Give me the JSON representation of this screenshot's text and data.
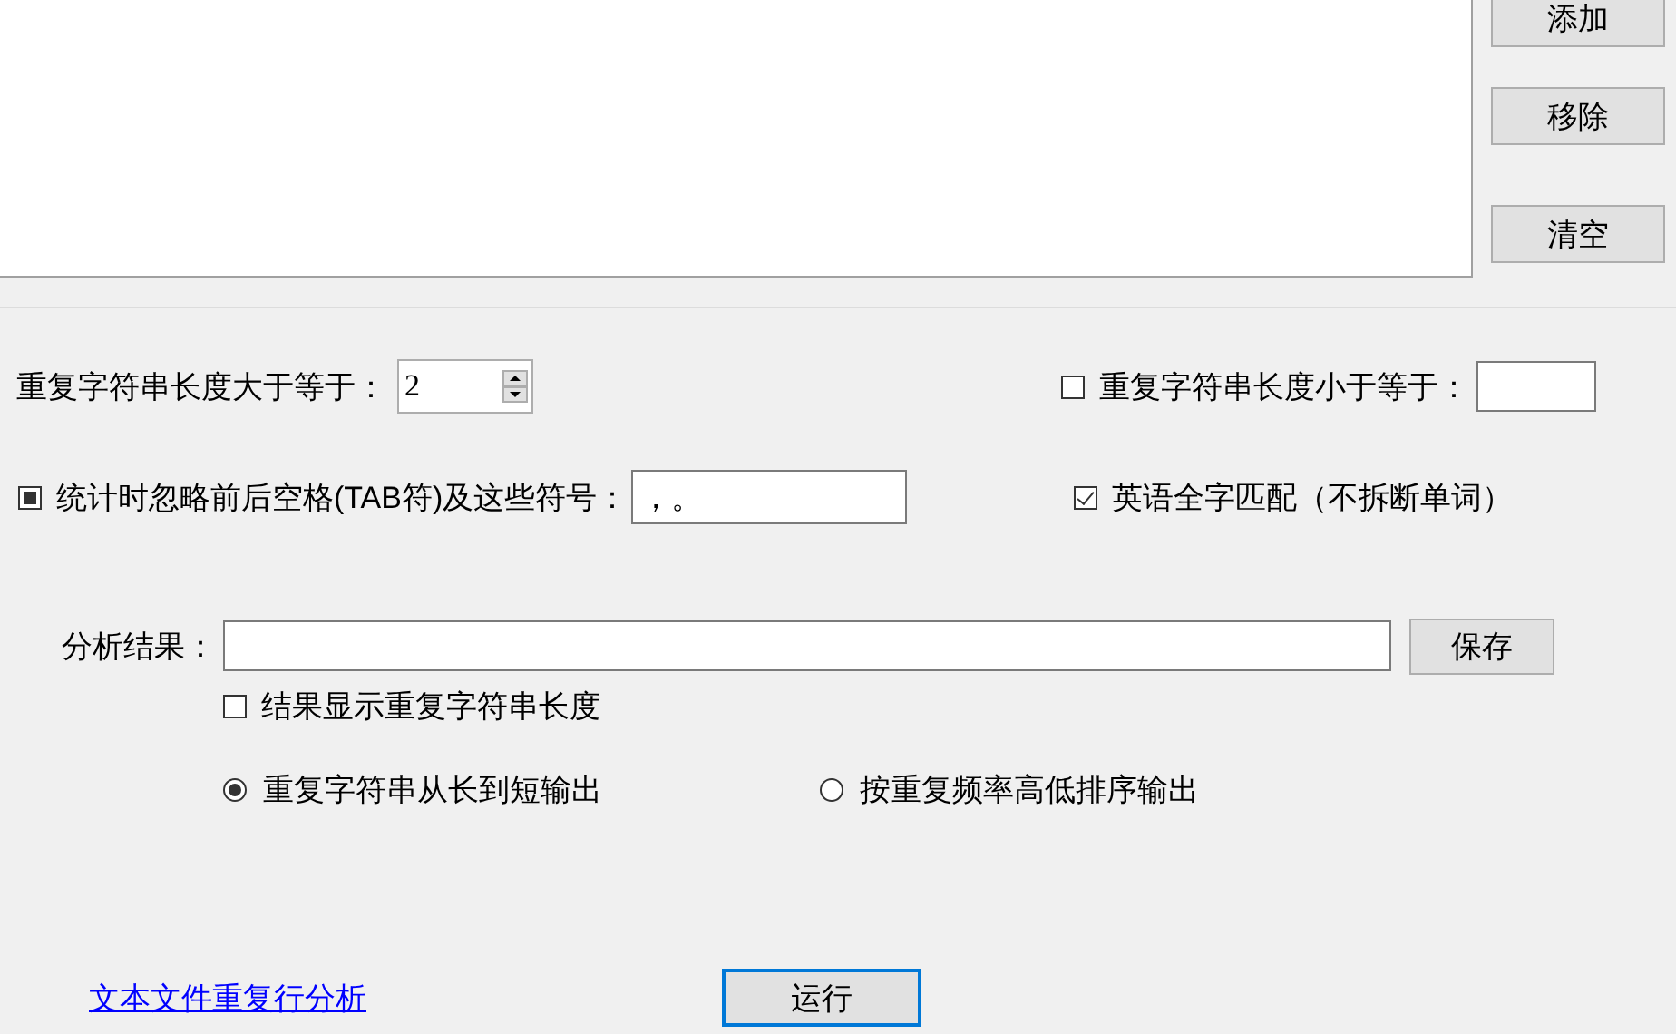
{
  "list_buttons": [
    {
      "label": "添加"
    },
    {
      "label": "移除"
    },
    {
      "label": "清空"
    }
  ],
  "min_length": {
    "label": "重复字符串长度大于等于：",
    "value": "2"
  },
  "max_length": {
    "label": "重复字符串长度小于等于：",
    "checked": false
  },
  "ignore_symbols": {
    "label": "统计时忽略前后空格(TAB符)及这些符号：",
    "checked": false,
    "indeterminate": true,
    "value": "，。"
  },
  "whole_word": {
    "label": "英语全字匹配（不拆断单词）",
    "checked": true
  },
  "result": {
    "label": "分析结果：",
    "save_button": "保存"
  },
  "show_length": {
    "label": "结果显示重复字符串长度",
    "checked": false
  },
  "sort_options": [
    {
      "label": "重复字符串从长到短输出",
      "selected": true
    },
    {
      "label": "按重复频率高低排序输出",
      "selected": false
    }
  ],
  "link": "文本文件重复行分析",
  "run_button": "运行"
}
